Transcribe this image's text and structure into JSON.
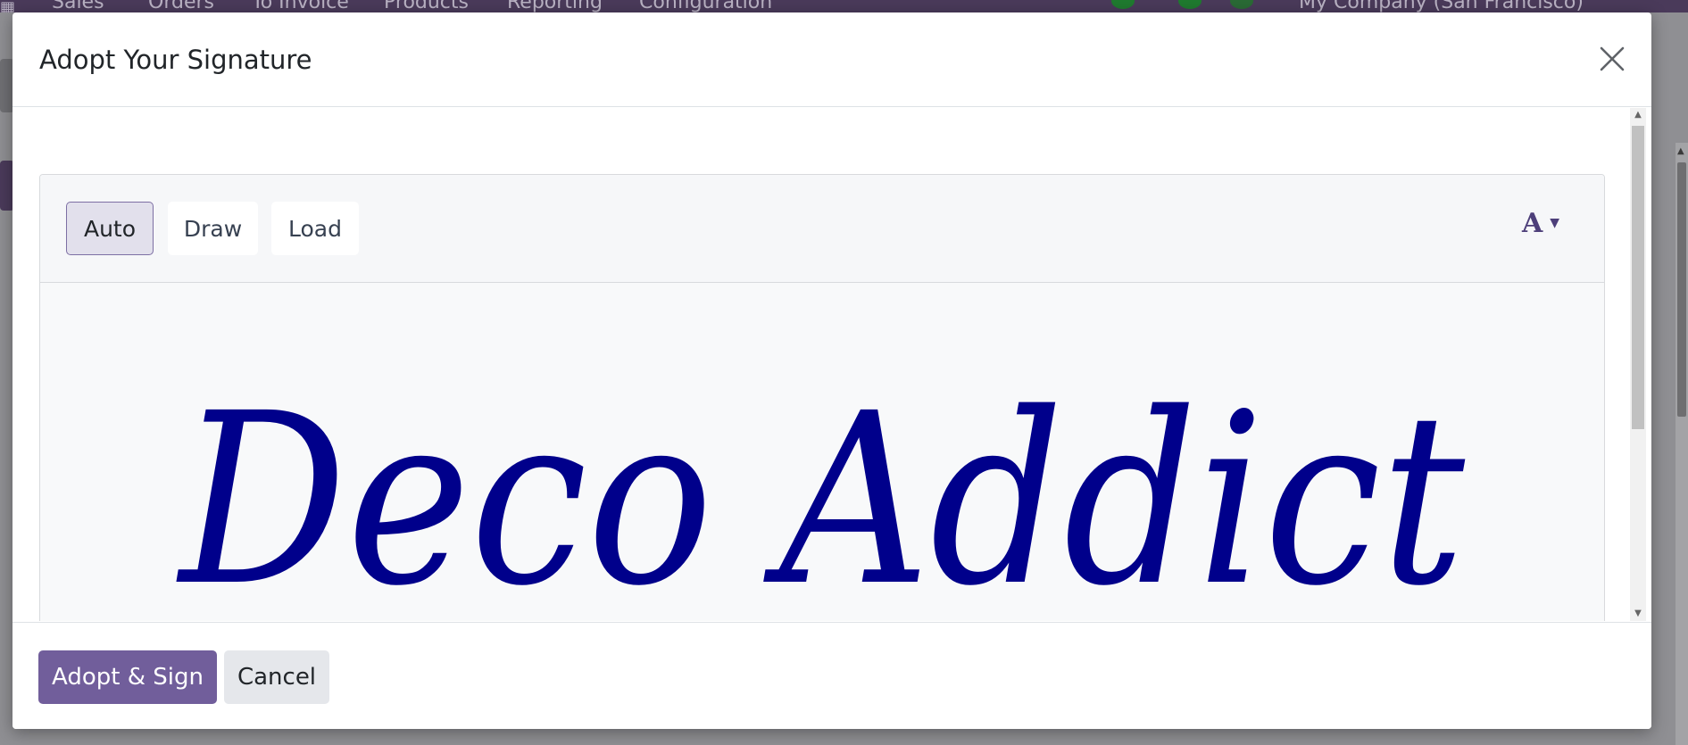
{
  "background": {
    "nav_items": [
      "Sales",
      "Orders",
      "To Invoice",
      "Products",
      "Reporting",
      "Configuration"
    ],
    "company": "My Company (San Francisco)"
  },
  "modal": {
    "title": "Adopt Your Signature",
    "close_icon": "close-icon",
    "modes": [
      {
        "label": "Auto",
        "active": true
      },
      {
        "label": "Draw",
        "active": false
      },
      {
        "label": "Load",
        "active": false
      }
    ],
    "font_selector": {
      "glyph": "A",
      "icon": "caret-down-icon"
    },
    "signature_text": "Deco Addict",
    "signature_color": "#00008b",
    "footer": {
      "adopt_label": "Adopt & Sign",
      "cancel_label": "Cancel"
    }
  },
  "colors": {
    "primary": "#715e9b",
    "nav_bg": "#4a3a5a"
  }
}
